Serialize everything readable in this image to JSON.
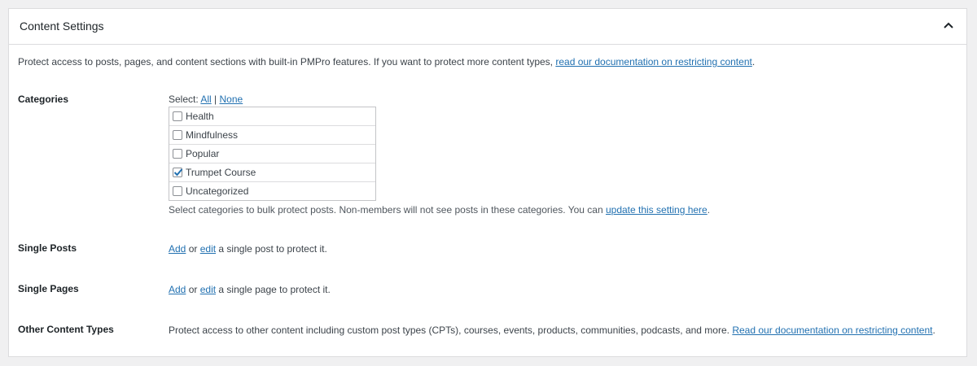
{
  "panel": {
    "title": "Content Settings",
    "toggle_icon": "chevron-up-icon"
  },
  "intro": {
    "text": "Protect access to posts, pages, and content sections with built-in PMPro features. If you want to protect more content types,",
    "link": "read our documentation on restricting content",
    "end": "."
  },
  "categories": {
    "label": "Categories",
    "select_prefix": "Select:",
    "select_all": "All",
    "separator": "|",
    "select_none": "None",
    "items": [
      {
        "label": "Health",
        "checked": false
      },
      {
        "label": "Mindfulness",
        "checked": false
      },
      {
        "label": "Popular",
        "checked": false
      },
      {
        "label": "Trumpet Course",
        "checked": true
      },
      {
        "label": "Uncategorized",
        "checked": false
      }
    ],
    "description": "Select categories to bulk protect posts. Non-members will not see posts in these categories. You can",
    "description_link": "update this setting here",
    "description_end": "."
  },
  "single_posts": {
    "label": "Single Posts",
    "add": "Add",
    "or": "or",
    "edit": "edit",
    "suffix": "a single post to protect it."
  },
  "single_pages": {
    "label": "Single Pages",
    "add": "Add",
    "or": "or",
    "edit": "edit",
    "suffix": "a single page to protect it."
  },
  "other_types": {
    "label": "Other Content Types",
    "text": "Protect access to other content including custom post types (CPTs), courses, events, products, communities, podcasts, and more.",
    "link": "Read our documentation on restricting content",
    "end": "."
  },
  "colors": {
    "link": "#2271b1",
    "border": "#dcdcde",
    "background": "#f0f0f1"
  }
}
